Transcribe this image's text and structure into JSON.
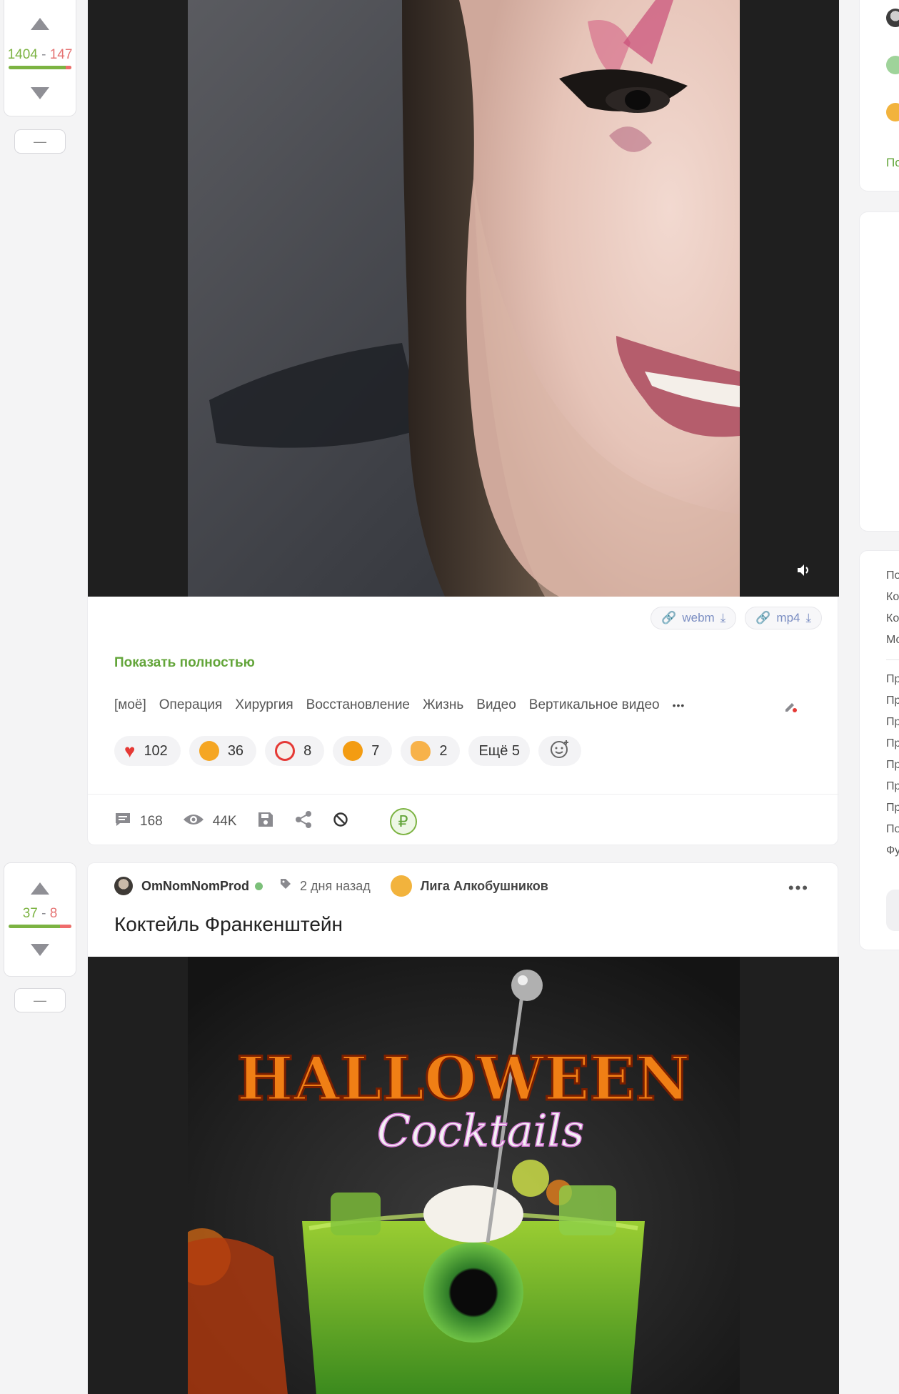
{
  "post1": {
    "vote": {
      "plus": "1404",
      "minus": "147",
      "positive_fraction": 0.905
    },
    "collapse_label": "—",
    "files": [
      {
        "label": "webm"
      },
      {
        "label": "mp4"
      }
    ],
    "show_full": "Показать полностью",
    "tags": [
      "[моё]",
      "Операция",
      "Хирургия",
      "Восстановление",
      "Жизнь",
      "Видео",
      "Вертикальное видео"
    ],
    "more_tags": "•••",
    "reactions": [
      {
        "icon": "heart-icon",
        "count": "102"
      },
      {
        "icon": "laughing-emoji-icon",
        "count": "36"
      },
      {
        "icon": "clown-emoji-icon",
        "count": "8"
      },
      {
        "icon": "shocked-emoji-icon",
        "count": "7"
      },
      {
        "icon": "clapping-emoji-icon",
        "count": "2"
      }
    ],
    "more_reactions": "Ещё 5",
    "stats": {
      "comments": "168",
      "views": "44K"
    }
  },
  "post2": {
    "vote": {
      "plus": "37",
      "minus": "8",
      "positive_fraction": 0.82
    },
    "collapse_label": "—",
    "author": "OmNomNomProd",
    "time": "2 дня назад",
    "community": "Лига Алкобушников",
    "title": "Коктейль Франкенштейн",
    "more": "•••",
    "video_text_line1": "HALLOWEEN",
    "video_text_line2": "Cocktails"
  },
  "sidebar": {
    "link1": "По",
    "menu1": [
      "По",
      "Ко",
      "Ко",
      "Мо"
    ],
    "menu2": [
      "Пр",
      "Пр",
      "Пр",
      "Пр",
      "Пр",
      "Пр",
      "Пр",
      "По",
      "Фу"
    ]
  },
  "colors": {
    "accent": "#63a53a",
    "plus": "#7cb342",
    "minus": "#e57373"
  }
}
